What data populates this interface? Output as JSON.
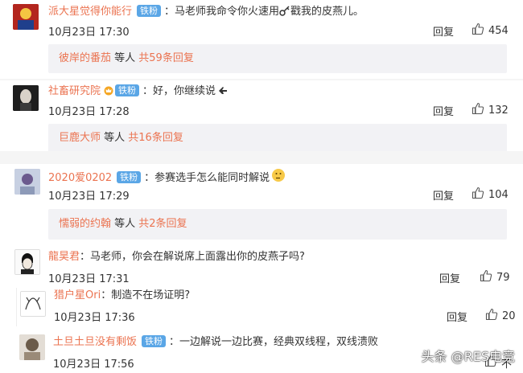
{
  "comments": [
    {
      "user": "派大星觉得你能行",
      "badge": "铁粉",
      "text_before": "：马老师我命令你火速用",
      "text_after": "戳我的皮燕儿。",
      "time": "10月23日 17:30",
      "reply_label": "回复",
      "likes": "454",
      "sub": {
        "who": "彼岸的番茄",
        "mid": " 等人 ",
        "count": "共59条回复"
      }
    },
    {
      "user": "社畜研究院",
      "badge": "铁粉",
      "text": "：好，你继续说",
      "time": "10月23日 17:28",
      "reply_label": "回复",
      "likes": "132",
      "sub": {
        "who": "巨鹿大师",
        "mid": " 等人 ",
        "count": "共16条回复"
      }
    },
    {
      "user": "2020爱0202",
      "badge": "铁粉",
      "text": "：参赛选手怎么能同时解说",
      "time": "10月23日 17:29",
      "reply_label": "回复",
      "likes": "104",
      "sub": {
        "who": "懦弱的约翰",
        "mid": " 等人 ",
        "count": "共2条回复"
      }
    },
    {
      "user": "龍昊君",
      "text": "：马老师，你会在解说席上面露出你的皮燕子吗?",
      "time": "10月23日 17:31",
      "reply_label": "回复",
      "likes": "79"
    },
    {
      "user": "猎户星Ori",
      "text": "：制造不在场证明?",
      "time": "10月23日 17:36",
      "reply_label": "回复",
      "likes": "20"
    },
    {
      "user": "土旦土旦没有剩饭",
      "badge": "铁粉",
      "text": "：一边解说一边比赛，经典双线程，双线溃败",
      "time": "10月23日 17:56",
      "reply_label": "回复",
      "likes": "不"
    }
  ],
  "watermark": "头条 @RES电竞",
  "colors": {
    "username": "#eb7350",
    "badge": "#5aa6e6",
    "reply_bg": "#f2f2f5"
  }
}
